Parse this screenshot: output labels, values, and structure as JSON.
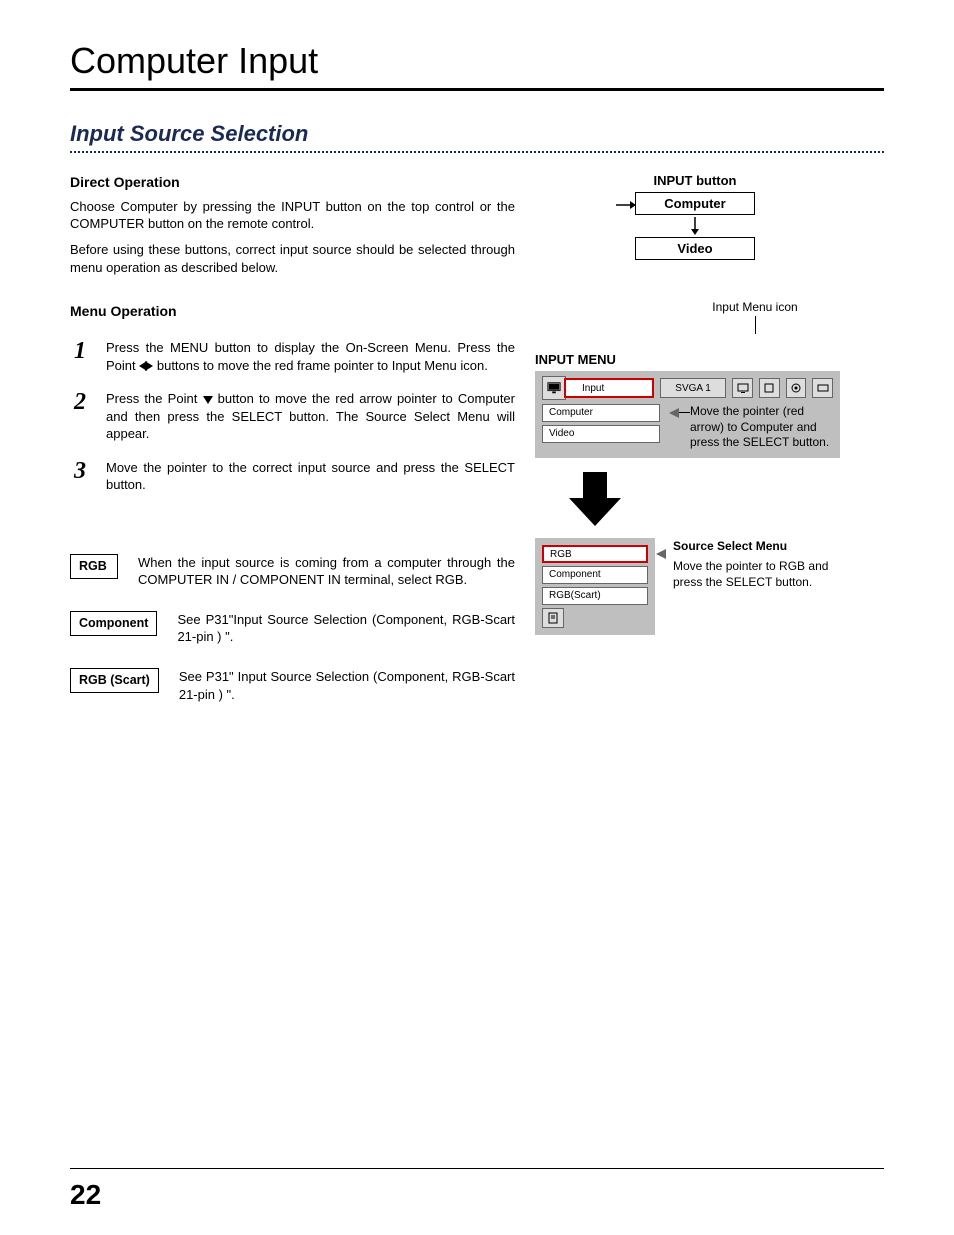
{
  "page": {
    "title": "Computer Input",
    "subtitle": "Input Source Selection",
    "number": "22"
  },
  "direct": {
    "heading": "Direct Operation",
    "p1": "Choose Computer by pressing the INPUT button on the top control or the COMPUTER button on the remote control.",
    "p2": "Before using these buttons, correct input source should be selected through menu operation as described below."
  },
  "menuop": {
    "heading": "Menu Operation",
    "steps": [
      {
        "n": "1",
        "pre": "Press the MENU button to display the On-Screen Menu. Press the Point ",
        "post": " buttons to move the red frame pointer to Input Menu icon."
      },
      {
        "n": "2",
        "pre": "Press the Point ",
        "post": " button to move the red arrow pointer to Computer and then press the SELECT button.  The Source Select Menu will appear."
      },
      {
        "n": "3",
        "pre": "Move the pointer to the correct input source and press the SELECT button.",
        "post": ""
      }
    ]
  },
  "defs": [
    {
      "label": "RGB",
      "text": "When the input source is coming from a computer through the COMPUTER IN / COMPONENT IN terminal, select RGB."
    },
    {
      "label": "Component",
      "text": "See P31\"Input Source Selection (Component, RGB-Scart 21-pin ) \"."
    },
    {
      "label": "RGB (Scart)",
      "text": "See P31\" Input Source Selection (Component, RGB-Scart 21-pin ) \"."
    }
  ],
  "right": {
    "inputbtn": {
      "title": "INPUT button",
      "computer": "Computer",
      "video": "Video"
    },
    "callout": "Input Menu icon",
    "menu_title": "INPUT MENU",
    "osd": {
      "tab": "Input",
      "svga": "SVGA 1",
      "items": [
        "Computer",
        "Video"
      ],
      "note": "Move the pointer (red arrow) to Computer and press the SELECT button."
    },
    "src": {
      "title": "Source Select Menu",
      "note": "Move the pointer to RGB and press the SELECT button.",
      "items": [
        "RGB",
        "Component",
        "RGB(Scart)"
      ]
    }
  }
}
